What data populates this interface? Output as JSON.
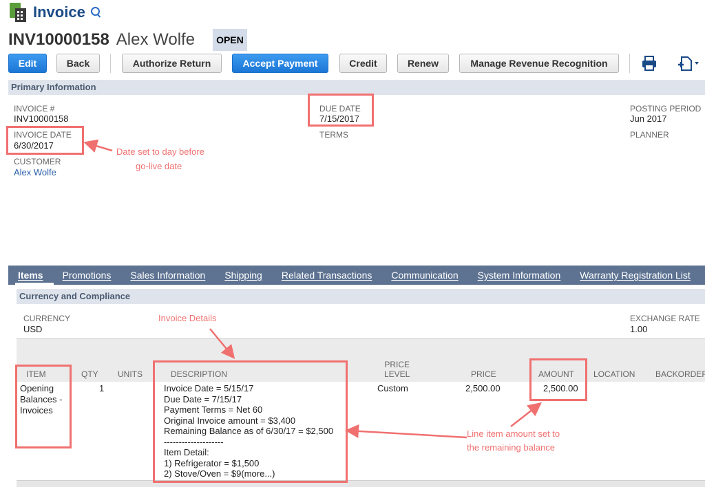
{
  "header": {
    "title": "Invoice",
    "record_number": "INV10000158",
    "customer_name": "Alex Wolfe",
    "status": "OPEN"
  },
  "toolbar": {
    "edit": "Edit",
    "back": "Back",
    "authorize_return": "Authorize Return",
    "accept_payment": "Accept Payment",
    "credit": "Credit",
    "renew": "Renew",
    "manage_revenue": "Manage Revenue Recognition"
  },
  "primary": {
    "section_title": "Primary Information",
    "invoice_num_label": "INVOICE #",
    "invoice_num": "INV10000158",
    "invoice_date_label": "INVOICE DATE",
    "invoice_date": "6/30/2017",
    "customer_label": "CUSTOMER",
    "customer": "Alex Wolfe",
    "due_date_label": "DUE DATE",
    "due_date": "7/15/2017",
    "terms_label": "TERMS",
    "posting_period_label": "POSTING PERIOD",
    "posting_period": "Jun 2017",
    "planner_label": "PLANNER"
  },
  "tabs": [
    "Items",
    "Promotions",
    "Sales Information",
    "Shipping",
    "Related Transactions",
    "Communication",
    "System Information",
    "Warranty Registration List"
  ],
  "currency": {
    "section_title": "Currency and Compliance",
    "currency_label": "CURRENCY",
    "currency": "USD",
    "exchange_label": "EXCHANGE RATE",
    "exchange": "1.00"
  },
  "items_table": {
    "headers": {
      "item": "ITEM",
      "qty": "QTY",
      "units": "UNITS",
      "description": "DESCRIPTION",
      "price_level_1": "PRICE",
      "price_level_2": "LEVEL",
      "price": "PRICE",
      "amount": "AMOUNT",
      "location": "LOCATION",
      "backorder": "BACKORDER"
    },
    "row": {
      "item_line1": "Opening",
      "item_line2": "Balances -",
      "item_line3": "Invoices",
      "qty": "1",
      "description": [
        "Invoice Date = 5/15/17",
        "Due Date = 7/15/17",
        "Payment Terms = Net 60",
        "Original Invoice amount = $3,400",
        "Remaining Balance as of 6/30/17 = $2,500",
        "--------------------",
        "Item Detail:",
        "1) Refrigerator = $1,500",
        "2) Stove/Oven = $9(more...)"
      ],
      "price_level": "Custom",
      "price": "2,500.00",
      "amount": "2,500.00"
    }
  },
  "annotations": {
    "date_note_1": "Date set to day before",
    "date_note_2": "go-live date",
    "details_note": "Invoice Details",
    "amount_note_1": "Line item amount set to",
    "amount_note_2": "the remaining balance"
  },
  "colors": {
    "accent": "#1b76d6",
    "tab_bar": "#5e7392",
    "annotation": "#f07070"
  },
  "icons": [
    "invoice-app-icon",
    "search-icon",
    "print-icon",
    "new-document-icon"
  ]
}
